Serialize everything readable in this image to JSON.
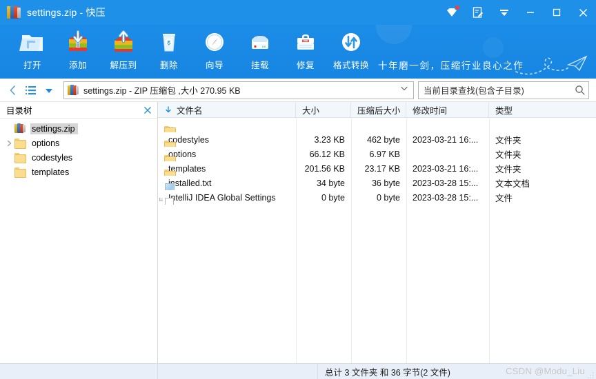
{
  "window": {
    "title": "settings.zip - 快压",
    "app_icon": "zip-archive-icon",
    "controls": {
      "vip_label": "vip-diamond-icon",
      "feedback_label": "feedback-edit-icon",
      "menu_label": "menu-chevron-icon",
      "minimize_label": "minimize-icon",
      "maximize_label": "maximize-icon",
      "close_label": "close-icon"
    }
  },
  "toolbar": {
    "items": [
      {
        "label": "打开",
        "icon": "open-folder-icon"
      },
      {
        "label": "添加",
        "icon": "add-archive-icon"
      },
      {
        "label": "解压到",
        "icon": "extract-archive-icon"
      },
      {
        "label": "删除",
        "icon": "trash-icon"
      },
      {
        "label": "向导",
        "icon": "compass-wizard-icon"
      },
      {
        "label": "挂载",
        "icon": "mount-drive-icon"
      },
      {
        "label": "修复",
        "icon": "repair-toolbox-icon"
      },
      {
        "label": "格式转换",
        "icon": "format-convert-icon"
      }
    ],
    "slogan": "十年磨一剑，压缩行业良心之作"
  },
  "addressbar": {
    "back_icon": "back-chevron-icon",
    "list_icon": "list-view-icon",
    "dropdown_icon": "dropdown-triangle-icon",
    "path_icon": "zip-archive-icon",
    "path_text": "settings.zip - ZIP 压缩包 ,大小 270.95 KB",
    "caret_icon": "chevron-down-icon"
  },
  "search": {
    "placeholder": "当前目录查找(包含子目录)",
    "value": "当前目录查找(包含子目录)",
    "icon": "search-icon"
  },
  "sidebar": {
    "title": "目录树",
    "close_icon": "close-icon",
    "root": {
      "label": "settings.zip",
      "icon": "zip-archive-icon",
      "selected": true
    },
    "items": [
      {
        "label": "options",
        "icon": "folder-icon",
        "expandable": true
      },
      {
        "label": "codestyles",
        "icon": "folder-icon",
        "expandable": false
      },
      {
        "label": "templates",
        "icon": "folder-icon",
        "expandable": false
      }
    ]
  },
  "filelist": {
    "columns": [
      {
        "key": "name",
        "label": "文件名",
        "sorted": true
      },
      {
        "key": "size",
        "label": "大小"
      },
      {
        "key": "csize",
        "label": "压缩后大小"
      },
      {
        "key": "time",
        "label": "修改时间"
      },
      {
        "key": "type",
        "label": "类型"
      }
    ],
    "rows": [
      {
        "name": "..",
        "icon": "folder-icon",
        "size": "",
        "csize": "",
        "time": "",
        "type": ""
      },
      {
        "name": "codestyles",
        "icon": "folder-icon",
        "size": "3.23 KB",
        "csize": "462 byte",
        "time": "2023-03-21   16:...",
        "type": "文件夹"
      },
      {
        "name": "options",
        "icon": "folder-icon",
        "size": "66.12 KB",
        "csize": "6.97 KB",
        "time": "",
        "type": "文件夹"
      },
      {
        "name": "templates",
        "icon": "folder-icon",
        "size": "201.56 KB",
        "csize": "23.17 KB",
        "time": "2023-03-21   16:...",
        "type": "文件夹"
      },
      {
        "name": "installed.txt",
        "icon": "text-file-icon",
        "size": "34 byte",
        "csize": "36 byte",
        "time": "2023-03-28   15:...",
        "type": "文本文档"
      },
      {
        "name": "IntelliJ IDEA Global Settings",
        "icon": "generic-file-icon",
        "size": "0 byte",
        "csize": "0 byte",
        "time": "2023-03-28   15:...",
        "type": "文件"
      }
    ]
  },
  "statusbar": {
    "summary": "总计 3 文件夹  和  36 字节(2 文件)",
    "watermark": "CSDN @Modu_Liu"
  },
  "colors": {
    "title_blue": "#1e90e8",
    "toolbar_blue": "#1a8ae6",
    "header_bg": "#f2f7fc",
    "status_bg": "#e8eff8",
    "selection": "#d5d5d5",
    "folder": "#fbdd8f"
  }
}
